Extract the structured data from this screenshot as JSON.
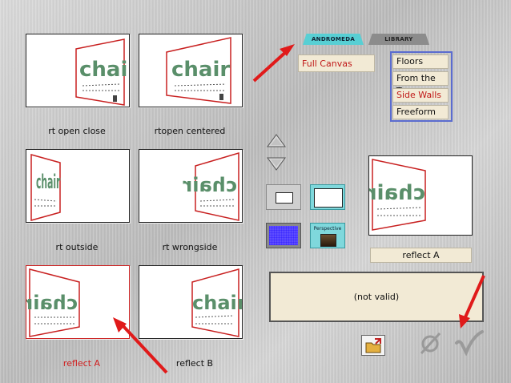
{
  "thumbnails": [
    {
      "caption": "rt open close"
    },
    {
      "caption": "rtopen centered"
    },
    {
      "caption": "rt outside"
    },
    {
      "caption": "rt wrongside"
    },
    {
      "caption": "reflect A"
    },
    {
      "caption": "reflect B"
    }
  ],
  "thumb_text": "chair",
  "selected_thumbnail": "reflect A",
  "tabs": {
    "andromeda": "ANDROMEDA",
    "library": "LIBRARY"
  },
  "canvas_select": {
    "value": "Full Canvas"
  },
  "placement_options": [
    "Floors",
    "From the Top",
    "Side Walls",
    "Freeform"
  ],
  "placement_selected": "Side Walls",
  "perspective_label": "Perspective",
  "preview": {
    "label": "reflect A",
    "text": "chair"
  },
  "status": {
    "text": "(not valid)"
  },
  "icons": [
    "arrow-up-icon",
    "arrow-down-icon",
    "folder-open-icon",
    "cancel-icon",
    "check-icon"
  ],
  "colors": {
    "accent_red": "#d02020",
    "panel_bg": "#f2ead5",
    "tab_cyan": "#58cfd4",
    "options_border": "#5b6ccf"
  }
}
